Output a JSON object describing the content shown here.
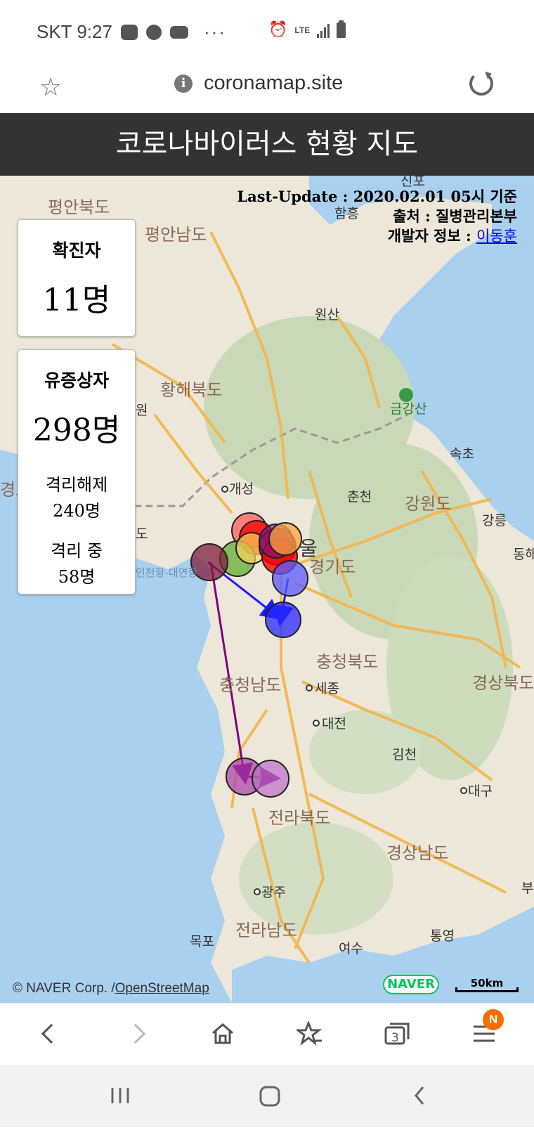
{
  "status_bar": {
    "carrier_time": "SKT 9:27",
    "more": "···",
    "network": "LTE"
  },
  "browser": {
    "url": "coronamap.site",
    "tab_count": "3",
    "menu_badge": "N"
  },
  "header": {
    "title": "코로나바이러스 현황 지도"
  },
  "update_info": {
    "last_update": "Last-Update : 2020.02.01 05시 기준",
    "source": "출처 : 질병관리본부",
    "developer_label": "개발자 정보 : ",
    "developer_name": "이동훈"
  },
  "confirmed": {
    "label": "확진자",
    "value": "11명"
  },
  "suspected": {
    "label": "유증상자",
    "value": "298명",
    "released_label": "격리해제",
    "released_value": "240명",
    "isolating_label": "격리 중",
    "isolating_value": "58명"
  },
  "map": {
    "labels": {
      "pyeongbuk": "평안북도",
      "pyeongnam": "평안남도",
      "hamheung": "함흥",
      "sinpo": "신포",
      "wonsan": "원산",
      "hwanghae": "황해북도",
      "geumgang": "금강산",
      "sokcho": "속초",
      "gaeseong": "개성",
      "chuncheon": "춘천",
      "gangwon": "강원도",
      "gangneung": "강릉",
      "seoul": "울",
      "gyeonggi": "경기도",
      "incheon": "인천항-대연항",
      "chungbuk": "충청북도",
      "chungnam": "충청남도",
      "sejong": "세종",
      "gyeongbuk": "경상북도",
      "daejeon": "대전",
      "gimcheon": "김천",
      "daegu": "대구",
      "jeonbuk": "전라북도",
      "gyeongnam": "경상남도",
      "gwangju": "광주",
      "jeonnam": "전라남도",
      "mokpo": "목포",
      "yeosu": "여수",
      "tongyeong": "통영",
      "left_won": "원",
      "left_do": "도",
      "left_kyeong": "경도",
      "donghae": "동해",
      "busan": "부"
    },
    "naver": "NAVER",
    "scale": "50km",
    "copyright_prefix": "© NAVER Corp. /",
    "copyright_link": "OpenStreetMap"
  },
  "colors": {
    "land": "#ece7d9",
    "mountain": "#c9d9b7",
    "sea": "#a9d0ee",
    "road": "#f4b54a",
    "header_bg": "#333333"
  }
}
